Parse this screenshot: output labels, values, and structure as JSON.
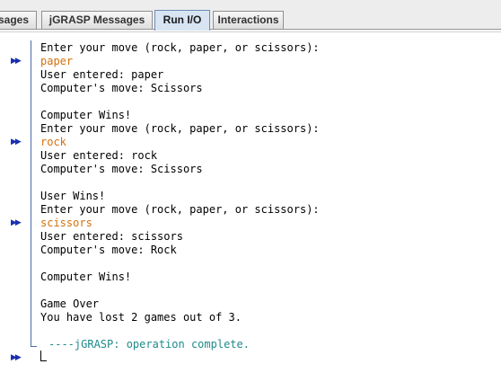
{
  "tabs": [
    {
      "label": "sages"
    },
    {
      "label": "jGRASP Messages"
    },
    {
      "label": "Run I/O",
      "active": true
    },
    {
      "label": "Interactions"
    }
  ],
  "console": {
    "lines": [
      {
        "text": "Enter your move (rock, paper, or scissors):",
        "kind": "output"
      },
      {
        "text": "paper",
        "kind": "input"
      },
      {
        "text": "User entered: paper",
        "kind": "output"
      },
      {
        "text": "Computer's move: Scissors",
        "kind": "output"
      },
      {
        "text": "",
        "kind": "output"
      },
      {
        "text": "Computer Wins!",
        "kind": "output"
      },
      {
        "text": "Enter your move (rock, paper, or scissors):",
        "kind": "output"
      },
      {
        "text": "rock",
        "kind": "input"
      },
      {
        "text": "User entered: rock",
        "kind": "output"
      },
      {
        "text": "Computer's move: Scissors",
        "kind": "output"
      },
      {
        "text": "",
        "kind": "output"
      },
      {
        "text": "User Wins!",
        "kind": "output"
      },
      {
        "text": "Enter your move (rock, paper, or scissors):",
        "kind": "output"
      },
      {
        "text": "scissors",
        "kind": "input"
      },
      {
        "text": "User entered: scissors",
        "kind": "output"
      },
      {
        "text": "Computer's move: Rock",
        "kind": "output"
      },
      {
        "text": "",
        "kind": "output"
      },
      {
        "text": "Computer Wins!",
        "kind": "output"
      },
      {
        "text": "",
        "kind": "output"
      },
      {
        "text": "Game Over",
        "kind": "output"
      },
      {
        "text": "You have lost 2 games out of 3.",
        "kind": "output"
      }
    ],
    "status": "----jGRASP: operation complete.",
    "input_marker_glyph": "▶▶"
  },
  "colors": {
    "input_text": "#d4700a",
    "status_text": "#1f8a8a",
    "input_marker": "#1a2fb0"
  }
}
